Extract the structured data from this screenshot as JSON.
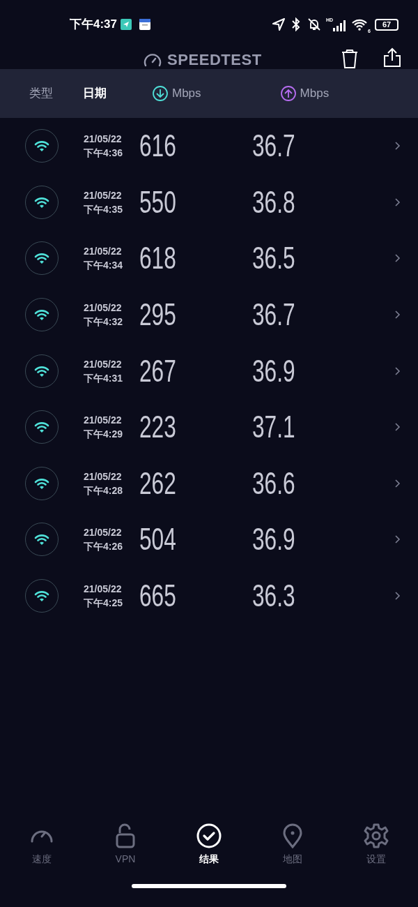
{
  "status_bar": {
    "time": "下午4:37",
    "network_label": "HD",
    "wifi_label": "6",
    "battery": "67"
  },
  "header": {
    "title": "SPEEDTEST"
  },
  "columns": [
    {
      "kind": "text",
      "label": "类型",
      "selected": false
    },
    {
      "kind": "text",
      "label": "日期",
      "selected": true
    },
    {
      "kind": "download",
      "label": "Mbps",
      "selected": false
    },
    {
      "kind": "upload",
      "label": "Mbps",
      "selected": false
    }
  ],
  "results": [
    {
      "date": "21/05/22",
      "time": "下午4:36",
      "download": "616",
      "upload": "36.7"
    },
    {
      "date": "21/05/22",
      "time": "下午4:35",
      "download": "550",
      "upload": "36.8"
    },
    {
      "date": "21/05/22",
      "time": "下午4:34",
      "download": "618",
      "upload": "36.5"
    },
    {
      "date": "21/05/22",
      "time": "下午4:32",
      "download": "295",
      "upload": "36.7"
    },
    {
      "date": "21/05/22",
      "time": "下午4:31",
      "download": "267",
      "upload": "36.9"
    },
    {
      "date": "21/05/22",
      "time": "下午4:29",
      "download": "223",
      "upload": "37.1"
    },
    {
      "date": "21/05/22",
      "time": "下午4:28",
      "download": "262",
      "upload": "36.6"
    },
    {
      "date": "21/05/22",
      "time": "下午4:26",
      "download": "504",
      "upload": "36.9"
    },
    {
      "date": "21/05/22",
      "time": "下午4:25",
      "download": "665",
      "upload": "36.3"
    }
  ],
  "nav": [
    {
      "kind": "speed",
      "label": "速度",
      "selected": false
    },
    {
      "kind": "vpn",
      "label": "VPN",
      "selected": false
    },
    {
      "kind": "results",
      "label": "结果",
      "selected": true
    },
    {
      "kind": "map",
      "label": "地图",
      "selected": false
    },
    {
      "kind": "settings",
      "label": "设置",
      "selected": false
    }
  ]
}
